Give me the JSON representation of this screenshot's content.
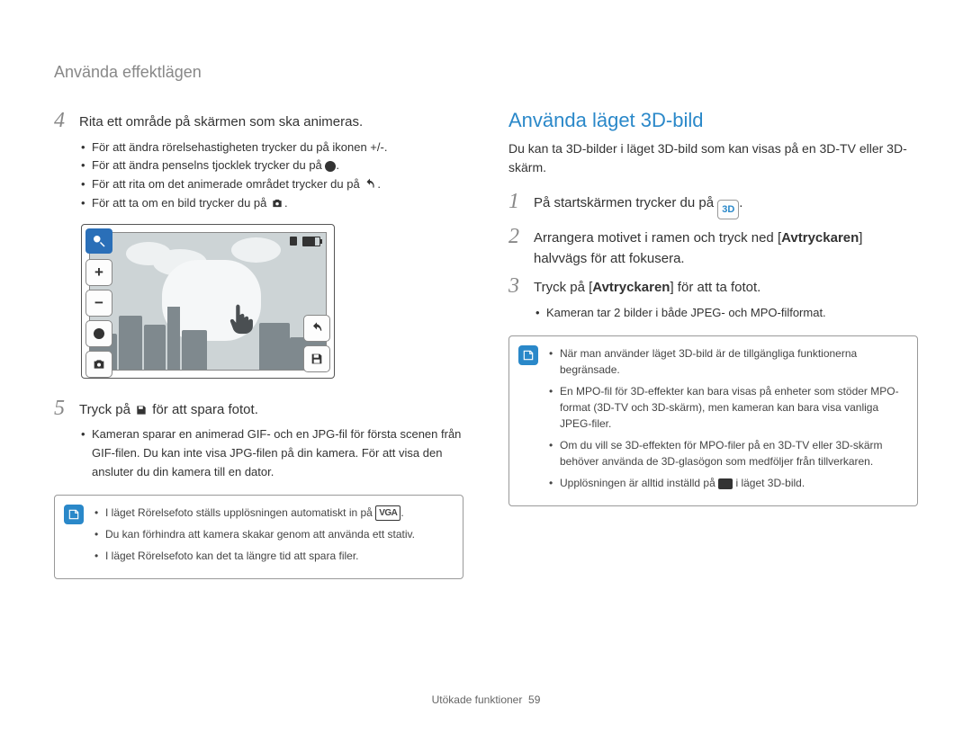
{
  "breadcrumb": "Använda effektlägen",
  "left": {
    "step4": {
      "num": "4",
      "text": "Rita ett område på skärmen som ska animeras.",
      "bullets": [
        "För att ändra rörelsehastigheten trycker du på ikonen +/-.",
        "För att ändra penselns tjocklek trycker du på",
        "För att rita om det animerade området trycker du på",
        "För att ta om en bild trycker du på"
      ]
    },
    "step5": {
      "num": "5",
      "text_before": "Tryck på ",
      "text_after": " för att spara fotot.",
      "bullets": [
        "Kameran sparar en animerad GIF- och en JPG-fil för första scenen från GIF-filen. Du kan inte visa JPG-filen på din kamera. För att visa den ansluter du din kamera till en dator."
      ]
    },
    "infobox": [
      "I läget Rörelsefoto ställs upplösningen automatiskt in på",
      "Du kan förhindra att kamera skakar genom att använda ett stativ.",
      "I läget Rörelsefoto kan det ta längre tid att spara filer."
    ],
    "vga_label": "VGA"
  },
  "right": {
    "heading": "Använda läget 3D-bild",
    "intro": "Du kan ta 3D-bilder i läget 3D-bild som kan visas på en 3D-TV eller 3D-skärm.",
    "step1": {
      "num": "1",
      "text_before": "På startskärmen trycker du på",
      "icon_text": "3D"
    },
    "step2": {
      "num": "2",
      "text_a": "Arrangera motivet i ramen och tryck ned [",
      "bold": "Avtryckaren",
      "text_b": "] halvvägs för att fokusera."
    },
    "step3": {
      "num": "3",
      "text_a": "Tryck på [",
      "bold": "Avtryckaren",
      "text_b": "] för att ta fotot.",
      "bullets": [
        "Kameran tar 2 bilder i både JPEG- och MPO-filformat."
      ]
    },
    "infobox": [
      "När man använder läget 3D-bild är de tillgängliga funktionerna begränsade.",
      "En MPO-fil för 3D-effekter kan bara visas på enheter som stöder MPO-format (3D-TV och 3D-skärm), men kameran kan bara visa vanliga JPEG-filer.",
      "Om du vill se 3D-effekten för MPO-filer på en 3D-TV eller 3D-skärm behöver använda de 3D-glasögon som medföljer från tillverkaren.",
      "Upplösningen är alltid inställd på        i läget 3D-bild."
    ]
  },
  "footer": {
    "section": "Utökade funktioner",
    "page": "59"
  }
}
